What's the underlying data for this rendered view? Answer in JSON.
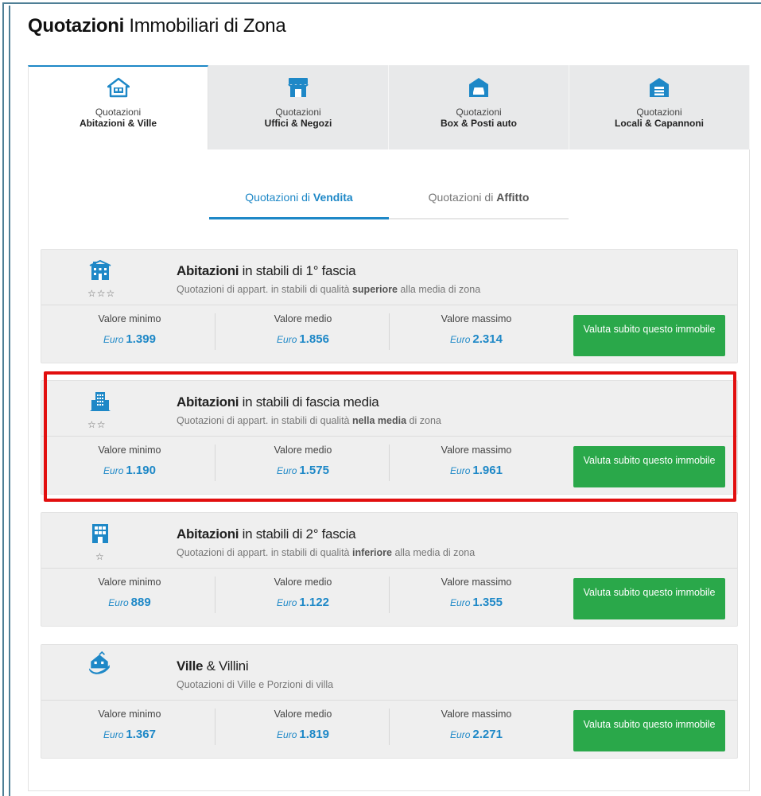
{
  "page": {
    "title_bold": "Quotazioni",
    "title_rest": " Immobiliari di Zona"
  },
  "tabs": [
    {
      "line1": "Quotazioni",
      "line2": "Abitazioni & Ville",
      "icon": "house-icon",
      "active": true
    },
    {
      "line1": "Quotazioni",
      "line2": "Uffici & Negozi",
      "icon": "shop-icon",
      "active": false
    },
    {
      "line1": "Quotazioni",
      "line2": "Box & Posti auto",
      "icon": "car-garage-icon",
      "active": false
    },
    {
      "line1": "Quotazioni",
      "line2": "Locali & Capannoni",
      "icon": "warehouse-icon",
      "active": false
    }
  ],
  "subtabs": [
    {
      "prefix": "Quotazioni di ",
      "bold": "Vendita",
      "active": true
    },
    {
      "prefix": "Quotazioni di ",
      "bold": "Affitto",
      "active": false
    }
  ],
  "labels": {
    "min": "Valore minimo",
    "avg": "Valore medio",
    "max": "Valore massimo",
    "currency": "Euro",
    "cta": "Valuta subito questo immobile"
  },
  "cards": [
    {
      "title_bold": "Abitazioni",
      "title_rest": " in stabili di 1° fascia",
      "sub_pre": "Quotazioni di appart. in stabili di qualità ",
      "sub_bold": "superiore",
      "sub_post": " alla media di zona",
      "stars": "☆☆☆",
      "icon": "mansion-icon",
      "min": "1.399",
      "avg": "1.856",
      "max": "2.314"
    },
    {
      "title_bold": "Abitazioni",
      "title_rest": " in stabili di fascia media",
      "sub_pre": "Quotazioni di appart. in stabili di qualità ",
      "sub_bold": "nella media",
      "sub_post": " di zona",
      "stars": "☆☆",
      "icon": "apartment-block-icon",
      "min": "1.190",
      "avg": "1.575",
      "max": "1.961"
    },
    {
      "title_bold": "Abitazioni",
      "title_rest": " in stabili di 2° fascia",
      "sub_pre": "Quotazioni di appart. in stabili di qualità ",
      "sub_bold": "inferiore",
      "sub_post": " alla media di zona",
      "stars": "☆",
      "icon": "building-icon",
      "min": "889",
      "avg": "1.122",
      "max": "1.355"
    },
    {
      "title_bold": "Ville",
      "title_rest": " & Villini",
      "sub_pre": "Quotazioni di Ville e Porzioni di villa",
      "sub_bold": "",
      "sub_post": "",
      "stars": "",
      "icon": "villa-hand-icon",
      "min": "1.367",
      "avg": "1.819",
      "max": "2.271"
    }
  ],
  "colors": {
    "accent": "#1e88c7",
    "cta": "#2aa84a",
    "highlight": "#e20f0f"
  }
}
